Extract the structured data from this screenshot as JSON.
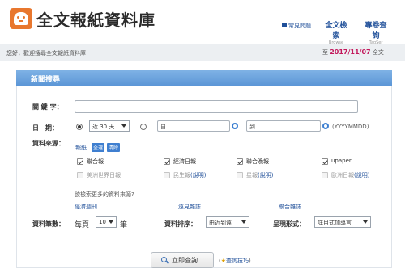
{
  "brand": {
    "title": "全文報紙資料庫"
  },
  "header": {
    "faq": "常見問題",
    "fulltext": {
      "label": "全文檢索",
      "sub": "Browse"
    },
    "topic": {
      "label": "專卷查詢",
      "sub": "TagSer"
    }
  },
  "status": {
    "welcome": "您好，歡迎搜尋全文報紙資料庫",
    "till_prefix": "至",
    "till_date": "2017/11/07",
    "till_suffix": "全文"
  },
  "panel": {
    "title": "新聞搜尋"
  },
  "form": {
    "keyword_label": "關 鍵 字：",
    "keyword_value": "",
    "date_label": "日　期：",
    "date_range_option": "近 30 天",
    "from_placeholder": "自",
    "to_placeholder": "到",
    "date_format_hint": "(YYYYMMDD)",
    "source_label": "資料來源：",
    "source_all": "報紙",
    "source_chip_select": "全選",
    "source_chip_clear": "清除",
    "sources": [
      {
        "name": "聯合報",
        "checked": true,
        "explain": ""
      },
      {
        "name": "經濟日報",
        "checked": true,
        "explain": ""
      },
      {
        "name": "聯合晚報",
        "checked": true,
        "explain": ""
      },
      {
        "name": "upaper",
        "checked": true,
        "explain": ""
      },
      {
        "name": "美洲世界日報",
        "checked": false,
        "explain": ""
      },
      {
        "name": "民生報",
        "checked": false,
        "explain": "(說明)"
      },
      {
        "name": "星報",
        "checked": false,
        "explain": "(說明)"
      },
      {
        "name": "歐洲日報",
        "checked": false,
        "explain": "(說明)"
      }
    ],
    "more_sources_q": "欲檢索更多的資料來源?",
    "more_links": [
      "經濟週刊",
      "遠見雜誌",
      "聯合雜誌"
    ],
    "count_label": "資料筆數：",
    "per_page_prefix": "每頁",
    "per_page_value": "10",
    "per_page_suffix": "筆",
    "sort_label": "資料排序：",
    "sort_value": "由近到遠",
    "display_label": "呈現形式：",
    "display_value": "詳目式加導言",
    "search_button": "立即查詢",
    "tips_prefix": "(",
    "tips_link": "查詢技巧",
    "tips_suffix": ")"
  }
}
